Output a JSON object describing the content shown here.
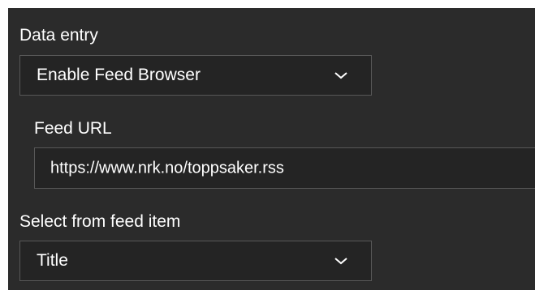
{
  "data_entry": {
    "label": "Data entry",
    "selected": "Enable Feed Browser",
    "icon": "chevron-down-icon"
  },
  "feed_url": {
    "label": "Feed URL",
    "value": "https://www.nrk.no/toppsaker.rss"
  },
  "select_from_feed_item": {
    "label": "Select from feed item",
    "selected": "Title",
    "icon": "chevron-down-icon"
  },
  "colors": {
    "panel_background": "#2b2b2b",
    "field_background": "#242424",
    "field_border": "#585858",
    "text": "#ffffff"
  }
}
